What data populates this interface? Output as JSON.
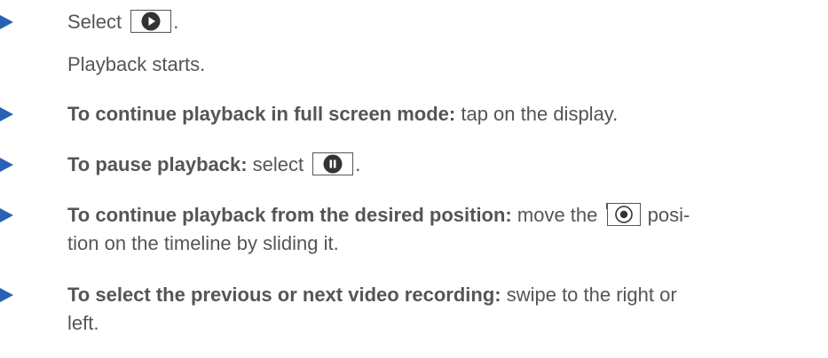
{
  "colors": {
    "bullet": "#2a60b5",
    "text": "#555555"
  },
  "steps": [
    {
      "text": "Select",
      "icon": "play-icon",
      "after": "."
    },
    {
      "result": "Playback starts."
    },
    {
      "bold": "To continue playback in full screen mode:",
      "text": " tap on the display."
    },
    {
      "bold": "To pause playback:",
      "text": " select",
      "icon": "pause-icon",
      "after": "."
    },
    {
      "bold": "To continue playback from the desired position:",
      "text": " move the",
      "icon": "slider-position-icon",
      "after": " posi-",
      "line2": "tion on the timeline by sliding it."
    },
    {
      "bold": "To select the previous or next video recording:",
      "text": " swipe to the right or",
      "line2": "left."
    }
  ]
}
